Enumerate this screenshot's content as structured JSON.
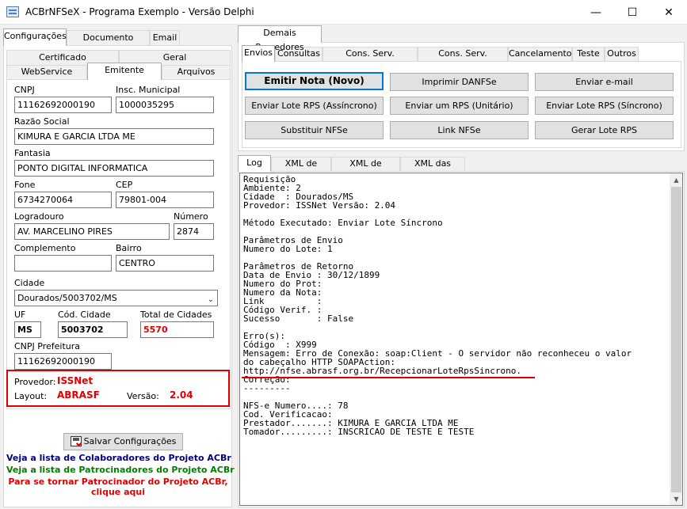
{
  "window": {
    "title": "ACBrNFSeX - Programa Exemplo - Versão Delphi",
    "minimize": "—",
    "maximize": "☐",
    "close": "✕"
  },
  "left_tabs": [
    "Configurações",
    "Documento Auxiliar",
    "Email"
  ],
  "sub_tabs_row1": [
    "Certificado",
    "Geral"
  ],
  "sub_tabs_row2": [
    "WebService",
    "Emitente",
    "Arquivos"
  ],
  "form": {
    "cnpj_label": "CNPJ",
    "cnpj": "11162692000190",
    "im_label": "Insc. Municipal",
    "im": "1000035295",
    "razao_label": "Razão Social",
    "razao": "KIMURA E GARCIA LTDA ME",
    "fantasia_label": "Fantasia",
    "fantasia": "PONTO DIGITAL INFORMATICA",
    "fone_label": "Fone",
    "fone": "6734270064",
    "cep_label": "CEP",
    "cep": "79801-004",
    "logradouro_label": "Logradouro",
    "logradouro": "AV. MARCELINO PIRES",
    "numero_label": "Número",
    "numero": "2874",
    "complemento_label": "Complemento",
    "complemento": "",
    "bairro_label": "Bairro",
    "bairro": "CENTRO",
    "cidade_label": "Cidade",
    "cidade": "Dourados/5003702/MS",
    "uf_label": "UF",
    "uf": "MS",
    "cod_cidade_label": "Cód. Cidade",
    "cod_cidade": "5003702",
    "total_cidades_label": "Total de Cidades",
    "total_cidades": "5570",
    "cnpj_pref_label": "CNPJ Prefeitura",
    "cnpj_pref": "11162692000190"
  },
  "provider_box": {
    "provedor_label": "Provedor:",
    "provedor": "ISSNet",
    "layout_label": "Layout:",
    "layout": "ABRASF",
    "versao_label": "Versão:",
    "versao": "2.04"
  },
  "save_button": "Salvar Configurações",
  "links": {
    "colaboradores": "Veja a lista de Colaboradores do Projeto ACBr",
    "patrocinadores": "Veja a lista de Patrocinadores do Projeto ACBr",
    "tornar_1": "Para se tornar Patrocinador do Projeto ACBr,",
    "tornar_2": "clique aqui",
    "colors": {
      "colaboradores": "#00007f",
      "patrocinadores": "#007f00",
      "tornar": "#e00000"
    }
  },
  "right_top_tab": "Demais Provedores",
  "action_tabs": [
    "Envios",
    "Consultas",
    "Cons. Serv. Prestados",
    "Cons. Serv. Tomados",
    "Cancelamento",
    "Teste",
    "Outros"
  ],
  "action_buttons": {
    "emitir": "Emitir Nota (Novo)",
    "imprimir": "Imprimir DANFSe",
    "email": "Enviar e-mail",
    "lote_async": "Enviar Lote RPS (Assíncrono)",
    "um_rps": "Enviar um RPS (Unitário)",
    "lote_sync": "Enviar Lote RPS (Síncrono)",
    "substituir": "Substituir NFSe",
    "link": "Link NFSe",
    "gerar_lote": "Gerar Lote RPS"
  },
  "log_tabs": [
    "Log",
    "XML de Envio",
    "XML de Retorno",
    "XML das Notas"
  ],
  "log_text": "Requisição\nAmbiente: 2\nCidade  : Dourados/MS\nProvedor: ISSNet Versão: 2.04\n\nMétodo Executado: Enviar Lote Síncrono\n\nParâmetros de Envio\nNumero do Lote: 1\n\nParâmetros de Retorno\nData de Envio : 30/12/1899\nNumero do Prot:\nNumero da Nota:\nLink          :\nCódigo Verif. :\nSucesso       : False\n\nErro(s):\nCódigo  : X999\nMensagem: Erro de Conexão: soap:Client - O servidor não reconheceu o valor\ndo cabeçalho HTTP SOAPAction:\nhttp://nfse.abrasf.org.br/RecepcionarLoteRpsSincrono.\nCorreção:\n---------\n\nNFS-e Numero....: 78\nCod. Verificacao:\nPrestador.......: KIMURA E GARCIA LTDA ME\nTomador.........: INSCRICAO DE TESTE E TESTE"
}
